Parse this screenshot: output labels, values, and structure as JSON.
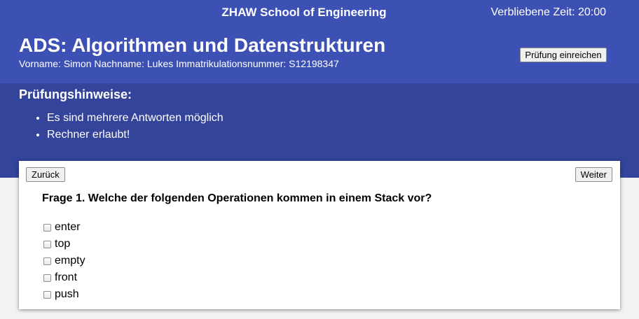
{
  "header": {
    "school": "ZHAW School of Engineering",
    "timer": "Verbliebene Zeit: 20:00",
    "title": "ADS: Algorithmen und Datenstrukturen",
    "student": "Vorname: Simon Nachname: Lukes Immatrikulationsnummer: S12198347",
    "submit_label": "Prüfung einreichen"
  },
  "notes": {
    "title": "Prüfungshinweise:",
    "items": [
      "Es sind mehrere Antworten möglich",
      "Rechner erlaubt!"
    ]
  },
  "question": {
    "back_label": "Zurück",
    "next_label": "Weiter",
    "text": "Frage 1. Welche der folgenden Operationen kommen in einem Stack vor?",
    "options": [
      "enter",
      "top",
      "empty",
      "front",
      "push"
    ]
  },
  "colors": {
    "header_bg": "#3d51b4",
    "notes_bg": "#33449a",
    "page_bg": "#f2f2f2"
  }
}
